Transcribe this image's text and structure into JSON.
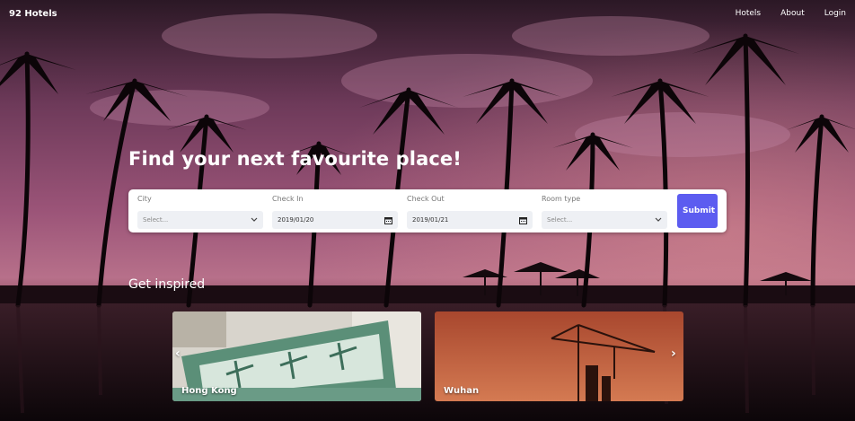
{
  "nav": {
    "brand": "92 Hotels",
    "links": [
      "Hotels",
      "About",
      "Login"
    ]
  },
  "hero": {
    "title": "Find your next favourite place!"
  },
  "search": {
    "city": {
      "label": "City",
      "placeholder": "Select..."
    },
    "check_in": {
      "label": "Check In",
      "value": "2019/01/20"
    },
    "check_out": {
      "label": "Check Out",
      "value": "2019/01/21"
    },
    "room_type": {
      "label": "Room type",
      "placeholder": "Select..."
    },
    "submit_label": "Submit"
  },
  "inspired": {
    "title": "Get inspired",
    "cards": [
      {
        "label": "Hong Kong"
      },
      {
        "label": "Wuhan"
      }
    ],
    "prev_icon": "‹",
    "next_icon": "›"
  },
  "colors": {
    "accent": "#5c5cf0",
    "sky_top": "#2a1622",
    "sky_mid": "#8a4a73",
    "sunset": "#b46a86"
  }
}
